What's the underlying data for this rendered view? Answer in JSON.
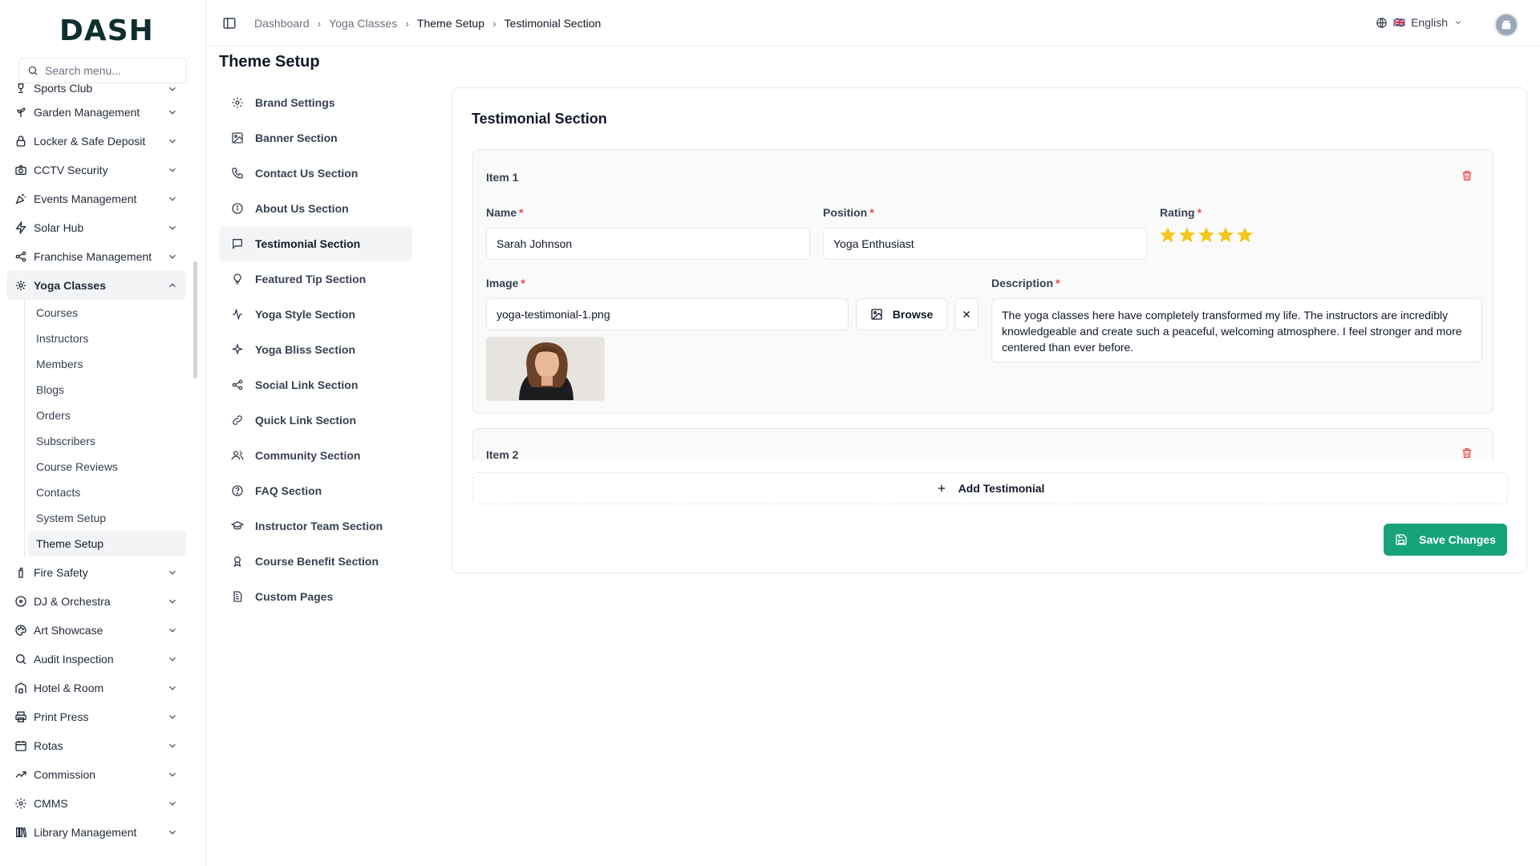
{
  "brand": {
    "logo_text": "DASH"
  },
  "search": {
    "placeholder": "Search menu..."
  },
  "sidebar": {
    "items": [
      {
        "label": "Sports Club",
        "icon": "trophy-icon"
      },
      {
        "label": "Garden Management",
        "icon": "plant-icon"
      },
      {
        "label": "Locker & Safe Deposit",
        "icon": "lock-icon"
      },
      {
        "label": "CCTV Security",
        "icon": "camera-icon"
      },
      {
        "label": "Events Management",
        "icon": "party-icon"
      },
      {
        "label": "Solar Hub",
        "icon": "bolt-icon"
      },
      {
        "label": "Franchise Management",
        "icon": "network-icon"
      },
      {
        "label": "Yoga Classes",
        "icon": "lotus-icon"
      }
    ],
    "yoga_sub": [
      "Courses",
      "Instructors",
      "Members",
      "Blogs",
      "Orders",
      "Subscribers",
      "Course Reviews",
      "Contacts",
      "System Setup",
      "Theme Setup"
    ],
    "items_after": [
      {
        "label": "Fire Safety",
        "icon": "fire-extinguisher-icon"
      },
      {
        "label": "DJ & Orchestra",
        "icon": "disc-icon"
      },
      {
        "label": "Art Showcase",
        "icon": "palette-icon"
      },
      {
        "label": "Audit Inspection",
        "icon": "magnifier-icon"
      },
      {
        "label": "Hotel & Room",
        "icon": "hotel-icon"
      },
      {
        "label": "Print Press",
        "icon": "printer-icon"
      },
      {
        "label": "Rotas",
        "icon": "calendar-icon"
      },
      {
        "label": "Commission",
        "icon": "trend-icon"
      },
      {
        "label": "CMMS",
        "icon": "gear-icon"
      },
      {
        "label": "Library Management",
        "icon": "books-icon"
      }
    ]
  },
  "breadcrumb": [
    "Dashboard",
    "Yoga Classes",
    "Theme Setup",
    "Testimonial Section"
  ],
  "language": {
    "label": "English",
    "flag": "🇬🇧"
  },
  "page": {
    "title": "Theme Setup"
  },
  "settings_nav": [
    {
      "label": "Brand Settings",
      "icon": "gear-icon"
    },
    {
      "label": "Banner Section",
      "icon": "image-icon"
    },
    {
      "label": "Contact Us Section",
      "icon": "phone-icon"
    },
    {
      "label": "About Us Section",
      "icon": "info-icon"
    },
    {
      "label": "Testimonial Section",
      "icon": "chat-icon"
    },
    {
      "label": "Featured Tip Section",
      "icon": "lightbulb-icon"
    },
    {
      "label": "Yoga Style Section",
      "icon": "activity-icon"
    },
    {
      "label": "Yoga Bliss Section",
      "icon": "sparkles-icon"
    },
    {
      "label": "Social Link Section",
      "icon": "share-icon"
    },
    {
      "label": "Quick Link Section",
      "icon": "link-icon"
    },
    {
      "label": "Community Section",
      "icon": "users-icon"
    },
    {
      "label": "FAQ Section",
      "icon": "help-icon"
    },
    {
      "label": "Instructor Team Section",
      "icon": "graduation-cap-icon"
    },
    {
      "label": "Course Benefit Section",
      "icon": "award-icon"
    },
    {
      "label": "Custom Pages",
      "icon": "file-icon"
    }
  ],
  "testimonial": {
    "title": "Testimonial Section",
    "item1": {
      "heading": "Item 1",
      "name_label": "Name",
      "name_value": "Sarah Johnson",
      "position_label": "Position",
      "position_value": "Yoga Enthusiast",
      "rating_label": "Rating",
      "rating": 5,
      "image_label": "Image",
      "image_value": "yoga-testimonial-1.png",
      "browse_label": "Browse",
      "description_label": "Description",
      "description_value": "The yoga classes here have completely transformed my life. The instructors are incredibly knowledgeable and create such a peaceful, welcoming atmosphere. I feel stronger and more centered than ever before."
    },
    "item2": {
      "heading": "Item 2"
    },
    "add_label": "Add Testimonial",
    "save_label": "Save Changes"
  },
  "colors": {
    "accent": "#16a37a",
    "star": "#f5c518",
    "danger": "#ef4444"
  }
}
